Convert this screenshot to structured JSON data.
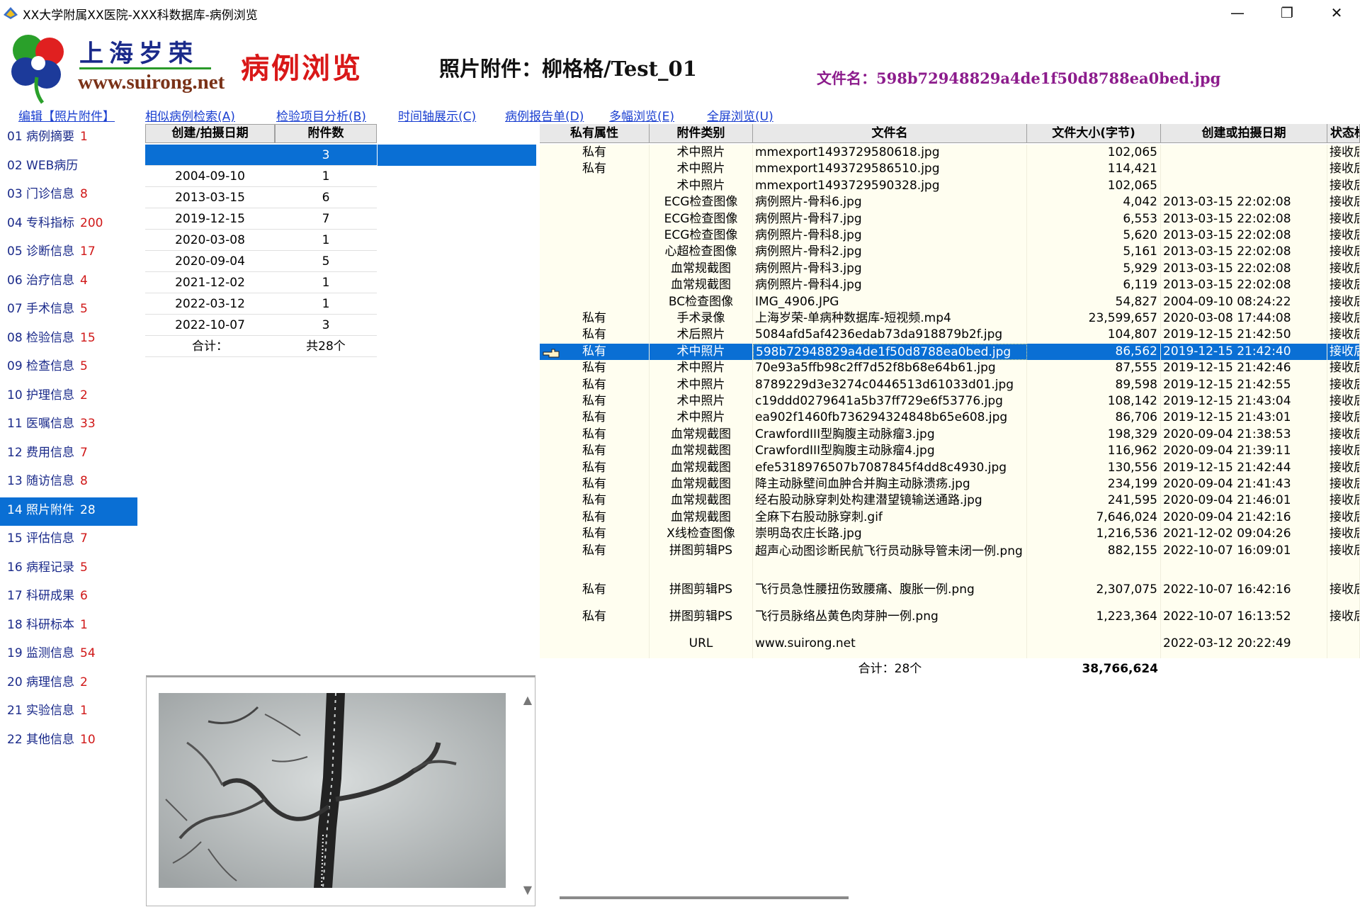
{
  "window": {
    "title": "XX大学附属XX医院-XXX科数据库-病例浏览",
    "minimize": "—",
    "maximize": "❐",
    "close": "✕"
  },
  "header": {
    "logo_cn": "上海岁荣",
    "logo_url": "www.suirong.net",
    "page_title": "病例浏览",
    "photo_heading": "照片附件：柳格格/Test_01",
    "filename_heading": "文件名：598b72948829a4de1f50d8788ea0bed.jpg"
  },
  "menu": [
    "编辑【照片附件】",
    "相似病例检索(A)",
    "检验项目分析(B)",
    "时间轴展示(C)",
    "病例报告单(D)",
    "多幅浏览(E)",
    "全屏浏览(U)"
  ],
  "sidebar": [
    {
      "label": "01 病例摘要",
      "count": "1"
    },
    {
      "label": "02 WEB病历",
      "count": ""
    },
    {
      "label": "03 门诊信息",
      "count": "8"
    },
    {
      "label": "04 专科指标",
      "count": "200"
    },
    {
      "label": "05 诊断信息",
      "count": "17"
    },
    {
      "label": "06 治疗信息",
      "count": "4"
    },
    {
      "label": "07 手术信息",
      "count": "5"
    },
    {
      "label": "08 检验信息",
      "count": "15"
    },
    {
      "label": "09 检查信息",
      "count": "5"
    },
    {
      "label": "10 护理信息",
      "count": "2"
    },
    {
      "label": "11 医嘱信息",
      "count": "33"
    },
    {
      "label": "12 费用信息",
      "count": "7"
    },
    {
      "label": "13 随访信息",
      "count": "8"
    },
    {
      "label": "14 照片附件",
      "count": "28"
    },
    {
      "label": "15 评估信息",
      "count": "7"
    },
    {
      "label": "16 病程记录",
      "count": "5"
    },
    {
      "label": "17 科研成果",
      "count": "6"
    },
    {
      "label": "18 科研标本",
      "count": "1"
    },
    {
      "label": "19 监测信息",
      "count": "54"
    },
    {
      "label": "20 病理信息",
      "count": "2"
    },
    {
      "label": "21 实验信息",
      "count": "1"
    },
    {
      "label": "22 其他信息",
      "count": "10"
    }
  ],
  "date_table": {
    "headers": [
      "创建/拍摄日期",
      "附件数"
    ],
    "rows": [
      [
        "",
        "3"
      ],
      [
        "2004-09-10",
        "1"
      ],
      [
        "2013-03-15",
        "6"
      ],
      [
        "2019-12-15",
        "7"
      ],
      [
        "2020-03-08",
        "1"
      ],
      [
        "2020-09-04",
        "5"
      ],
      [
        "2021-12-02",
        "1"
      ],
      [
        "2022-03-12",
        "1"
      ],
      [
        "2022-10-07",
        "3"
      ]
    ],
    "total": [
      "合计：",
      "共28个"
    ]
  },
  "file_table": {
    "headers": [
      "私有属性",
      "附件类别",
      "文件名",
      "文件大小(字节)",
      "创建或拍摄日期",
      "状态标"
    ],
    "rows": [
      {
        "priv": "私有",
        "type": "术中照片",
        "name": "mmexport1493729580618.jpg",
        "size": "102,065",
        "date": "",
        "status": "接收后"
      },
      {
        "priv": "私有",
        "type": "术中照片",
        "name": "mmexport1493729586510.jpg",
        "size": "114,421",
        "date": "",
        "status": "接收后"
      },
      {
        "priv": "",
        "type": "术中照片",
        "name": "mmexport1493729590328.jpg",
        "size": "102,065",
        "date": "",
        "status": "接收后"
      },
      {
        "priv": "",
        "type": "ECG检查图像",
        "name": "病例照片-骨科6.jpg",
        "size": "4,042",
        "date": "2013-03-15 22:02:08",
        "status": "接收后"
      },
      {
        "priv": "",
        "type": "ECG检查图像",
        "name": "病例照片-骨科7.jpg",
        "size": "6,553",
        "date": "2013-03-15 22:02:08",
        "status": "接收后"
      },
      {
        "priv": "",
        "type": "ECG检查图像",
        "name": "病例照片-骨科8.jpg",
        "size": "5,620",
        "date": "2013-03-15 22:02:08",
        "status": "接收后"
      },
      {
        "priv": "",
        "type": "心超检查图像",
        "name": "病例照片-骨科2.jpg",
        "size": "5,161",
        "date": "2013-03-15 22:02:08",
        "status": "接收后"
      },
      {
        "priv": "",
        "type": "血常规截图",
        "name": "病例照片-骨科3.jpg",
        "size": "5,929",
        "date": "2013-03-15 22:02:08",
        "status": "接收后"
      },
      {
        "priv": "",
        "type": "血常规截图",
        "name": "病例照片-骨科4.jpg",
        "size": "6,119",
        "date": "2013-03-15 22:02:08",
        "status": "接收后"
      },
      {
        "priv": "",
        "type": "BC检查图像",
        "name": "IMG_4906.JPG",
        "size": "54,827",
        "date": "2004-09-10 08:24:22",
        "status": "接收后"
      },
      {
        "priv": "私有",
        "type": "手术录像",
        "name": "上海岁荣-单病种数据库-短视频.mp4",
        "size": "23,599,657",
        "date": "2020-03-08 17:44:08",
        "status": "接收后"
      },
      {
        "priv": "私有",
        "type": "术后照片",
        "name": "5084afd5af4236edab73da918879b2f.jpg",
        "size": "104,807",
        "date": "2019-12-15 21:42:50",
        "status": "接收后"
      },
      {
        "priv": "私有",
        "type": "术中照片",
        "name": "598b72948829a4de1f50d8788ea0bed.jpg",
        "size": "86,562",
        "date": "2019-12-15 21:42:40",
        "status": "接收后"
      },
      {
        "priv": "私有",
        "type": "术中照片",
        "name": "70e93a5ffb98c2ff7d52f8b68e64b61.jpg",
        "size": "87,555",
        "date": "2019-12-15 21:42:46",
        "status": "接收后"
      },
      {
        "priv": "私有",
        "type": "术中照片",
        "name": "8789229d3e3274c0446513d61033d01.jpg",
        "size": "89,598",
        "date": "2019-12-15 21:42:55",
        "status": "接收后"
      },
      {
        "priv": "私有",
        "type": "术中照片",
        "name": "c19ddd0279641a5b37ff729e6f53776.jpg",
        "size": "108,142",
        "date": "2019-12-15 21:43:04",
        "status": "接收后"
      },
      {
        "priv": "私有",
        "type": "术中照片",
        "name": "ea902f1460fb736294324848b65e608.jpg",
        "size": "86,706",
        "date": "2019-12-15 21:43:01",
        "status": "接收后"
      },
      {
        "priv": "私有",
        "type": "血常规截图",
        "name": "CrawfordIII型胸腹主动脉瘤3.jpg",
        "size": "198,329",
        "date": "2020-09-04 21:38:53",
        "status": "接收后"
      },
      {
        "priv": "私有",
        "type": "血常规截图",
        "name": "CrawfordIII型胸腹主动脉瘤4.jpg",
        "size": "116,962",
        "date": "2020-09-04 21:39:11",
        "status": "接收后"
      },
      {
        "priv": "私有",
        "type": "血常规截图",
        "name": "efe5318976507b7087845f4dd8c4930.jpg",
        "size": "130,556",
        "date": "2019-12-15 21:42:44",
        "status": "接收后"
      },
      {
        "priv": "私有",
        "type": "血常规截图",
        "name": "降主动脉壁间血肿合并胸主动脉溃疡.jpg",
        "size": "234,199",
        "date": "2020-09-04 21:41:43",
        "status": "接收后"
      },
      {
        "priv": "私有",
        "type": "血常规截图",
        "name": "经右股动脉穿刺处构建潜望镜输送通路.jpg",
        "size": "241,595",
        "date": "2020-09-04 21:46:01",
        "status": "接收后"
      },
      {
        "priv": "私有",
        "type": "血常规截图",
        "name": "全麻下右股动脉穿刺.gif",
        "size": "7,646,024",
        "date": "2020-09-04 21:42:16",
        "status": "接收后"
      },
      {
        "priv": "私有",
        "type": "X线检查图像",
        "name": "崇明岛农庄长路.jpg",
        "size": "1,216,536",
        "date": "2021-12-02 09:04:26",
        "status": "接收后"
      },
      {
        "priv": "私有",
        "type": "拼图剪辑PS",
        "name": "超声心动图诊断民航飞行员动脉导管未闭一例.png",
        "size": "882,155",
        "date": "2022-10-07 16:09:01",
        "status": "接收后"
      },
      {
        "priv": "私有",
        "type": "拼图剪辑PS",
        "name": "飞行员急性腰扭伤致腰痛、腹胀一例.png",
        "size": "2,307,075",
        "date": "2022-10-07 16:42:16",
        "status": "接收后"
      },
      {
        "priv": "私有",
        "type": "拼图剪辑PS",
        "name": "飞行员脉络丛黄色肉芽肿一例.png",
        "size": "1,223,364",
        "date": "2022-10-07 16:13:52",
        "status": "接收后"
      },
      {
        "priv": "",
        "type": "URL",
        "name": "www.suirong.net",
        "size": "",
        "date": "2022-03-12 20:22:49",
        "status": ""
      }
    ],
    "total_label": "合计：28个",
    "total_size": "38,766,624"
  },
  "colors": {
    "selection": "#0a6fd4",
    "row_alt": "#fffef0",
    "link": "#1a3fd0",
    "count_red": "#d01818",
    "title_red": "#d91818",
    "filename_purple": "#8c1c8c"
  },
  "icons": {
    "app": "app-logo-icon",
    "pointer": "hand-pointer-icon",
    "scroll_up": "▲",
    "scroll_down": "▼"
  }
}
